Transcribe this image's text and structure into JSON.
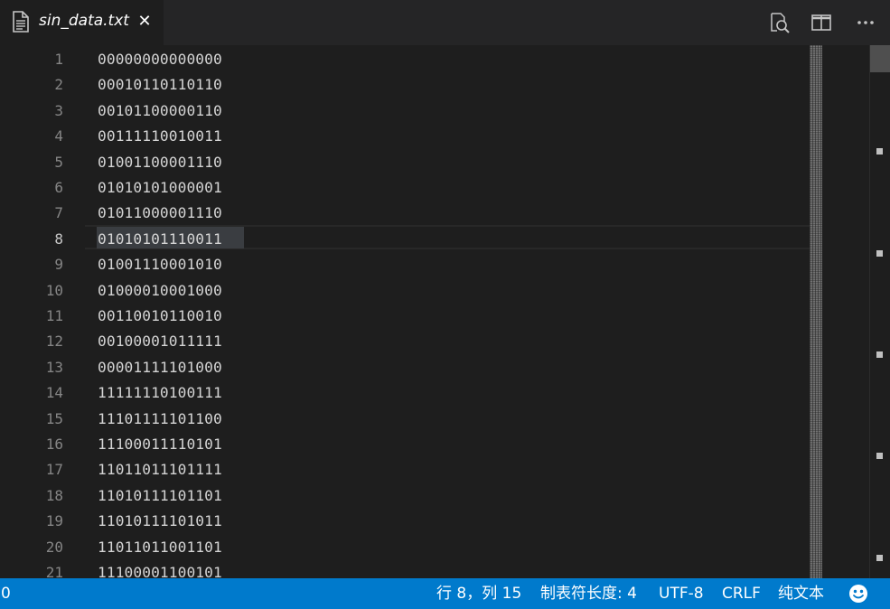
{
  "tab": {
    "title": "sin_data.txt",
    "close_glyph": "✕",
    "icon": "file-text-icon"
  },
  "toolbar": {
    "icons": [
      "find-in-file-icon",
      "split-editor-icon",
      "more-actions-icon"
    ]
  },
  "editor": {
    "lines": [
      {
        "number": "1",
        "text": "00000000000000"
      },
      {
        "number": "2",
        "text": "00010110110110"
      },
      {
        "number": "3",
        "text": "00101100000110"
      },
      {
        "number": "4",
        "text": "00111110010011"
      },
      {
        "number": "5",
        "text": "01001100001110"
      },
      {
        "number": "6",
        "text": "01010101000001"
      },
      {
        "number": "7",
        "text": "01011000001110"
      },
      {
        "number": "8",
        "text": "01010101110011"
      },
      {
        "number": "9",
        "text": "01001110001010"
      },
      {
        "number": "10",
        "text": "01000010001000"
      },
      {
        "number": "11",
        "text": "00110010110010"
      },
      {
        "number": "12",
        "text": "00100001011111"
      },
      {
        "number": "13",
        "text": "00001111101000"
      },
      {
        "number": "14",
        "text": "11111110100111"
      },
      {
        "number": "15",
        "text": "11101111101100"
      },
      {
        "number": "16",
        "text": "11100011110101"
      },
      {
        "number": "17",
        "text": "11011011101111"
      },
      {
        "number": "18",
        "text": "11010111101101"
      },
      {
        "number": "19",
        "text": "11010111101011"
      },
      {
        "number": "20",
        "text": "11011011001101"
      },
      {
        "number": "21",
        "text": "11100001100101"
      }
    ],
    "active_line": 8
  },
  "statusbar": {
    "left_value": "0",
    "position": "行 8，列 15",
    "tab_size": "制表符长度: 4",
    "encoding": "UTF-8",
    "eol": "CRLF",
    "language": "纯文本",
    "feedback_icon": "smiley-feedback-icon"
  },
  "colors": {
    "editor_bg": "#1e1e1e",
    "tabbar_bg": "#252526",
    "statusbar_bg": "#007acc",
    "text": "#d4d4d4",
    "line_number": "#858585"
  }
}
